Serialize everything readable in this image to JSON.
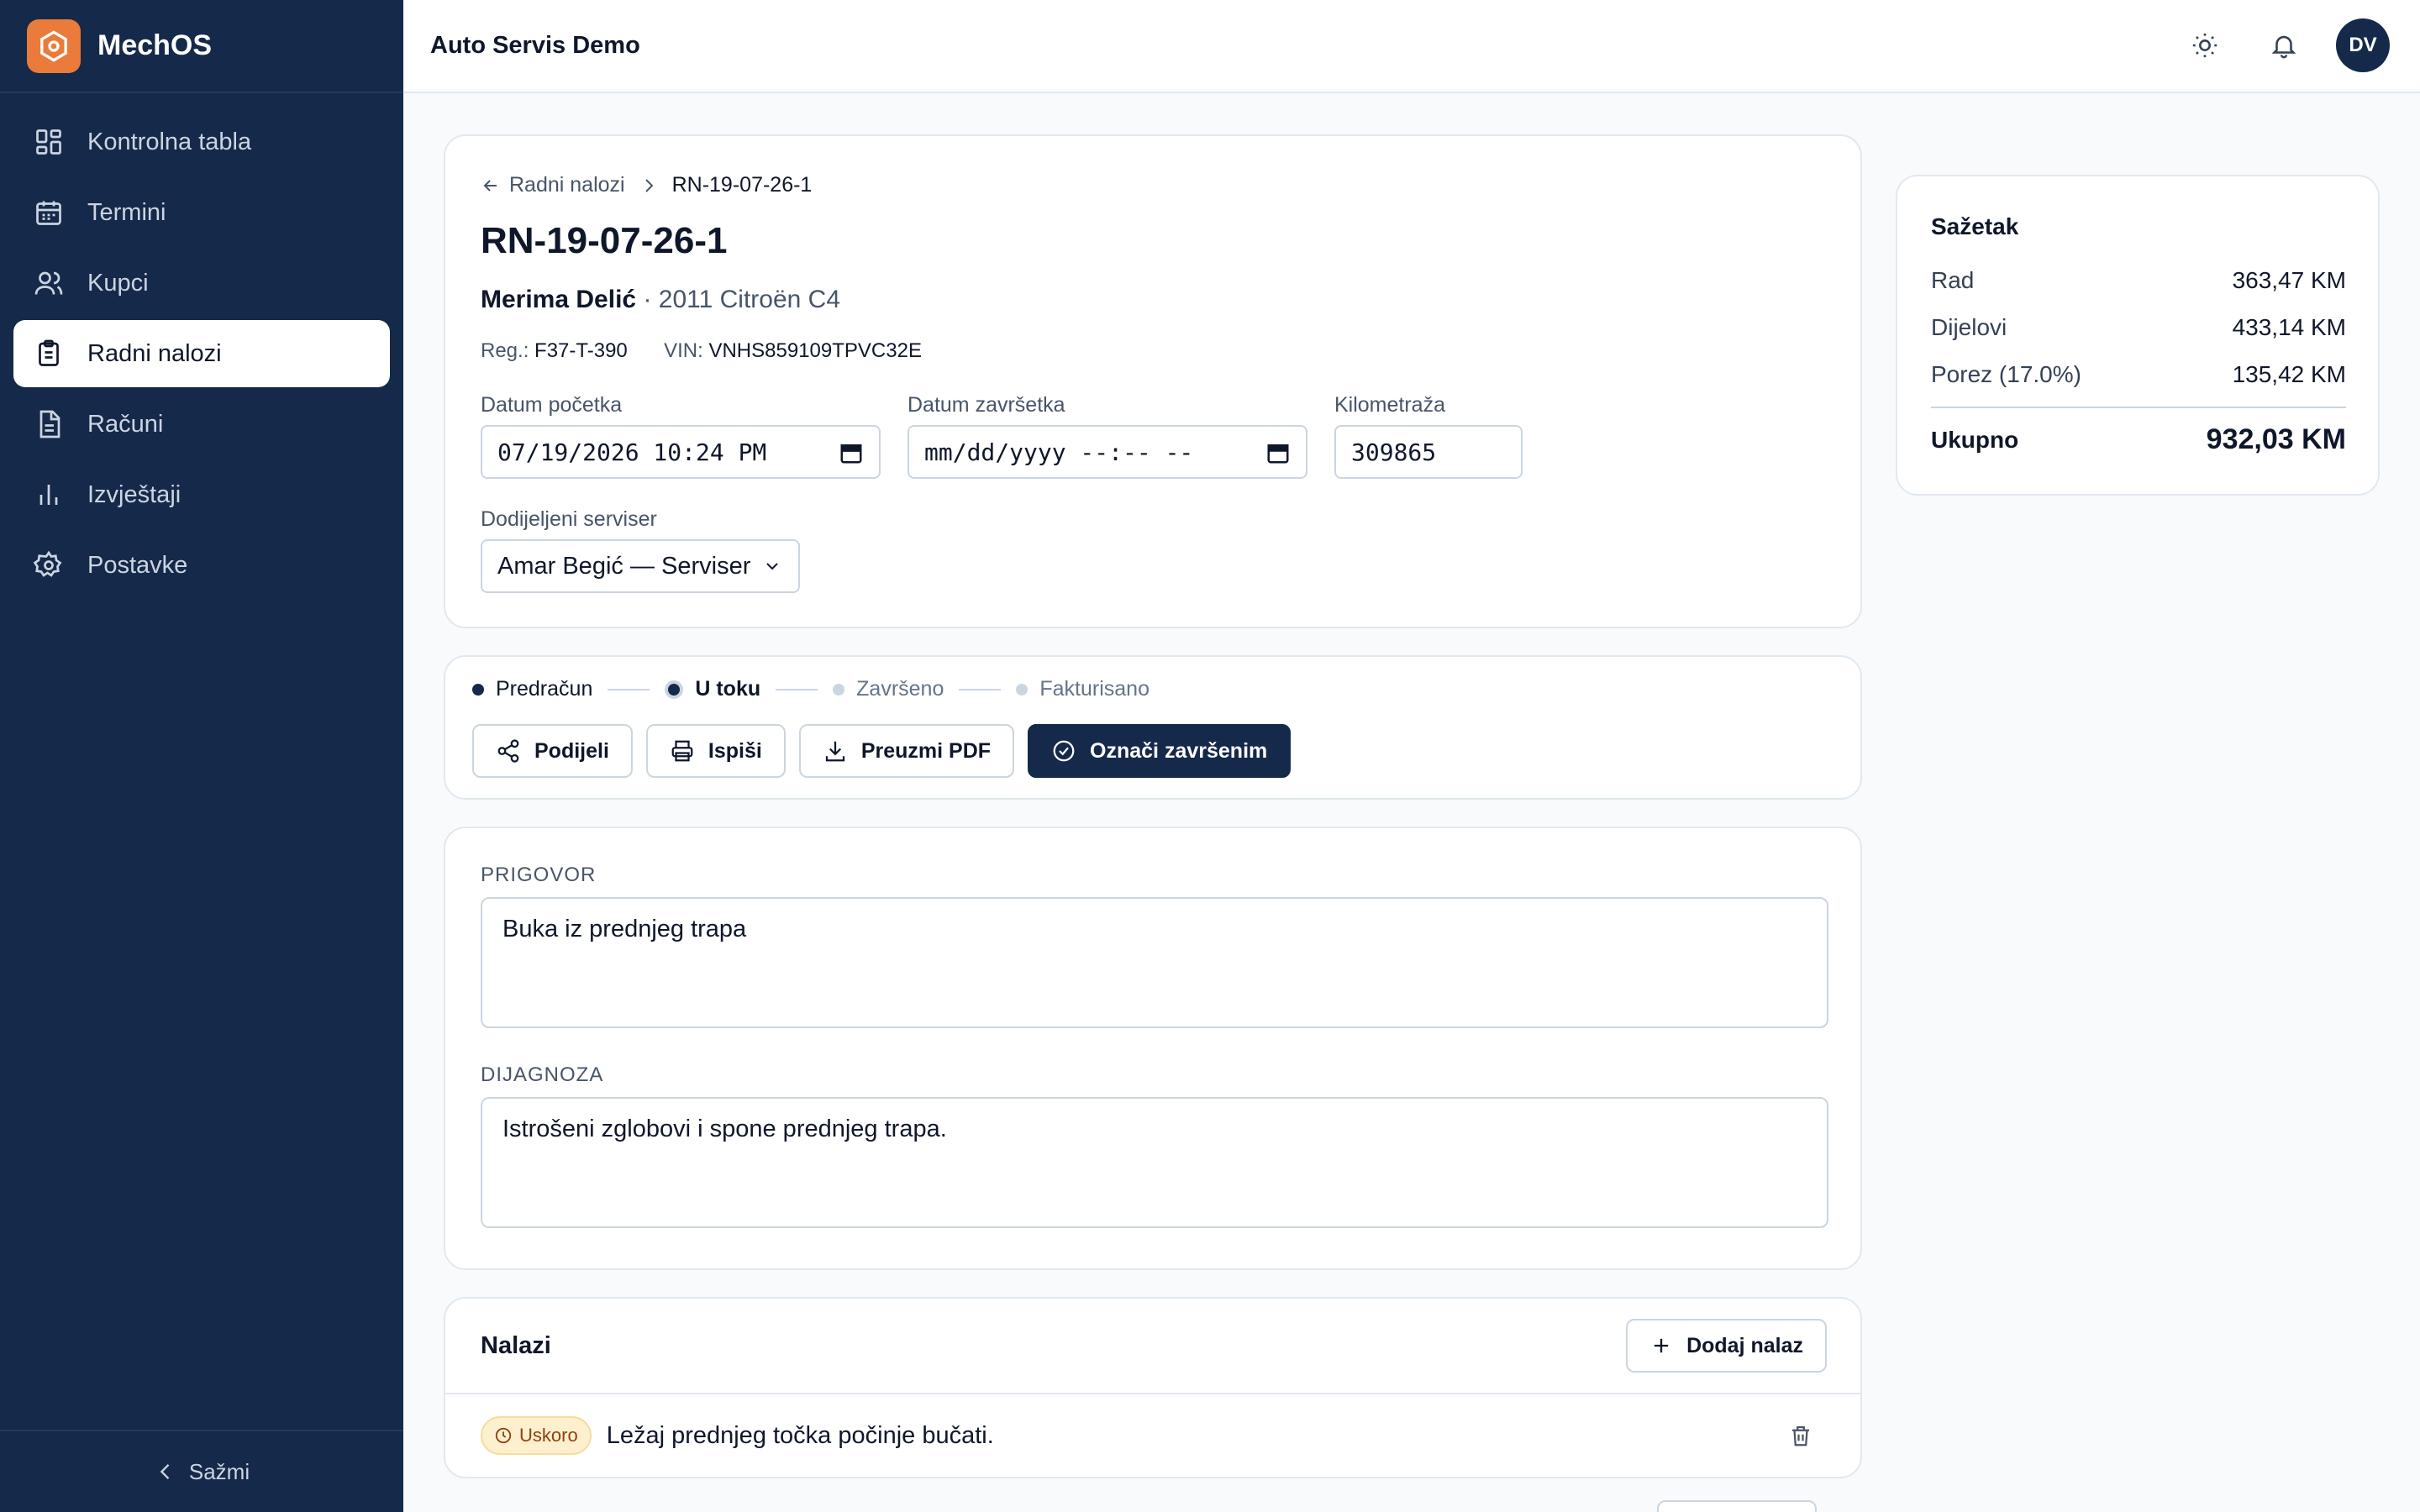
{
  "app": {
    "name": "MechOS",
    "workspace": "Auto Servis Demo",
    "user_initials": "DV",
    "accent": "#15294a",
    "brand_color": "#ea7b3a"
  },
  "sidebar": {
    "items": [
      {
        "label": "Kontrolna tabla",
        "icon": "dashboard-icon",
        "active": false
      },
      {
        "label": "Termini",
        "icon": "calendar-icon",
        "active": false
      },
      {
        "label": "Kupci",
        "icon": "users-icon",
        "active": false
      },
      {
        "label": "Radni nalozi",
        "icon": "clipboard-icon",
        "active": true
      },
      {
        "label": "Računi",
        "icon": "file-icon",
        "active": false
      },
      {
        "label": "Izvještaji",
        "icon": "bar-chart-icon",
        "active": false
      },
      {
        "label": "Postavke",
        "icon": "gear-icon",
        "active": false
      }
    ],
    "collapse_label": "Sažmi"
  },
  "work_order": {
    "breadcrumb_parent": "Radni nalozi",
    "breadcrumb_current": "RN-19-07-26-1",
    "number": "RN-19-07-26-1",
    "customer": "Merima Delić",
    "vehicle": "· 2011 Citroën C4",
    "reg_label": "Reg.:",
    "reg_value": "F37-T-390",
    "vin_label": "VIN:",
    "vin_value": "VNHS859109TPVC32E",
    "start_label": "Datum početka",
    "start_value": "07/19/2026 10:24 PM",
    "end_label": "Datum završetka",
    "end_value": "mm/dd/yyyy --:-- --",
    "mileage_label": "Kilometraža",
    "mileage_value": "309865",
    "tech_label": "Dodijeljeni serviser",
    "tech_value": "Amar Begić — Serviser"
  },
  "status": {
    "steps": [
      {
        "label": "Predračun",
        "state": "done"
      },
      {
        "label": "U toku",
        "state": "current"
      },
      {
        "label": "Završeno",
        "state": "pending"
      },
      {
        "label": "Fakturisano",
        "state": "pending"
      }
    ],
    "actions": {
      "share": "Podijeli",
      "print": "Ispiši",
      "pdf": "Preuzmi PDF",
      "complete": "Označi završenim"
    }
  },
  "notes": {
    "complaint_label": "PRIGOVOR",
    "complaint_value": "Buka iz prednjeg trapa",
    "diagnosis_label": "DIJAGNOZA",
    "diagnosis_value": "Istrošeni zglobovi i spone prednjeg trapa."
  },
  "findings": {
    "title": "Nalazi",
    "add_label": "Dodaj nalaz",
    "items": [
      {
        "badge": "Uskoro",
        "text": "Ležaj prednjeg točka počinje bučati."
      }
    ]
  },
  "summary": {
    "title": "Sažetak",
    "labor_label": "Rad",
    "labor_value": "363,47 KM",
    "parts_label": "Dijelovi",
    "parts_value": "433,14 KM",
    "tax_label": "Porez (17.0%)",
    "tax_value": "135,42 KM",
    "total_label": "Ukupno",
    "total_value": "932,03 KM"
  }
}
